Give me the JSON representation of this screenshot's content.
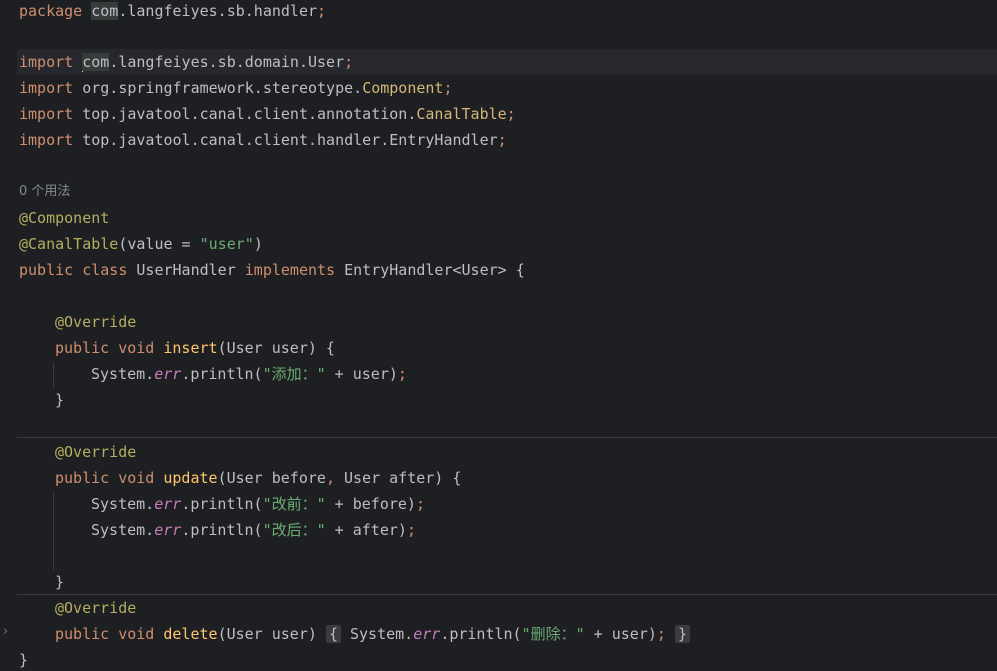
{
  "editor": {
    "hint_usages": "0 个用法",
    "lines": {
      "package_kw": "package",
      "package_name_hl": "com",
      "package_name_rest": ".langfeiyes.sb.handler",
      "semi": ";",
      "import_kw": "import",
      "import1_a": "com",
      "import1_b": ".langfeiyes.sb.domain.User",
      "import2_a": "org.springframework.stereotype.",
      "import2_b": "Component",
      "import3_a": "top.javatool.canal.client.annotation.",
      "import3_b": "CanalTable",
      "import4": "top.javatool.canal.client.handler.EntryHandler",
      "ann_component": "@Component",
      "ann_canal": "@CanalTable",
      "ann_canal_args_open": "(value = ",
      "ann_canal_value": "\"user\"",
      "ann_canal_args_close": ")",
      "class_public": "public",
      "class_kw": "class",
      "class_name": "UserHandler",
      "implements_kw": "implements",
      "class_iface": "EntryHandler<User> {",
      "override": "@Override",
      "public_kw": "public",
      "void_kw": "void",
      "m_insert": "insert",
      "m_insert_params": "(User user) {",
      "system": "System.",
      "err": "err",
      "println": ".println(",
      "str_add": "\"添加：\"",
      "plus_user": " + user)",
      "close_brace": "}",
      "m_update": "update",
      "m_update_params_a": "(User before",
      "comma": ",",
      "m_update_params_b": " User after) {",
      "str_before": "\"改前：\"",
      "plus_before": " + before)",
      "str_after": "\"改后：\"",
      "plus_after": " + after)",
      "m_delete": "delete",
      "m_delete_params": "(User user) ",
      "open_brace": "{",
      "str_delete": "\"删除：\"",
      "plus_user2": " + user)",
      "final_brace": "}"
    }
  },
  "colors": {
    "background": "#1e1f22",
    "keyword": "#cf8e6d",
    "annotation": "#b3ae60",
    "string": "#6aab73",
    "method_decl": "#ffc66d",
    "static_field": "#c77dbb",
    "text": "#bcbec4"
  }
}
